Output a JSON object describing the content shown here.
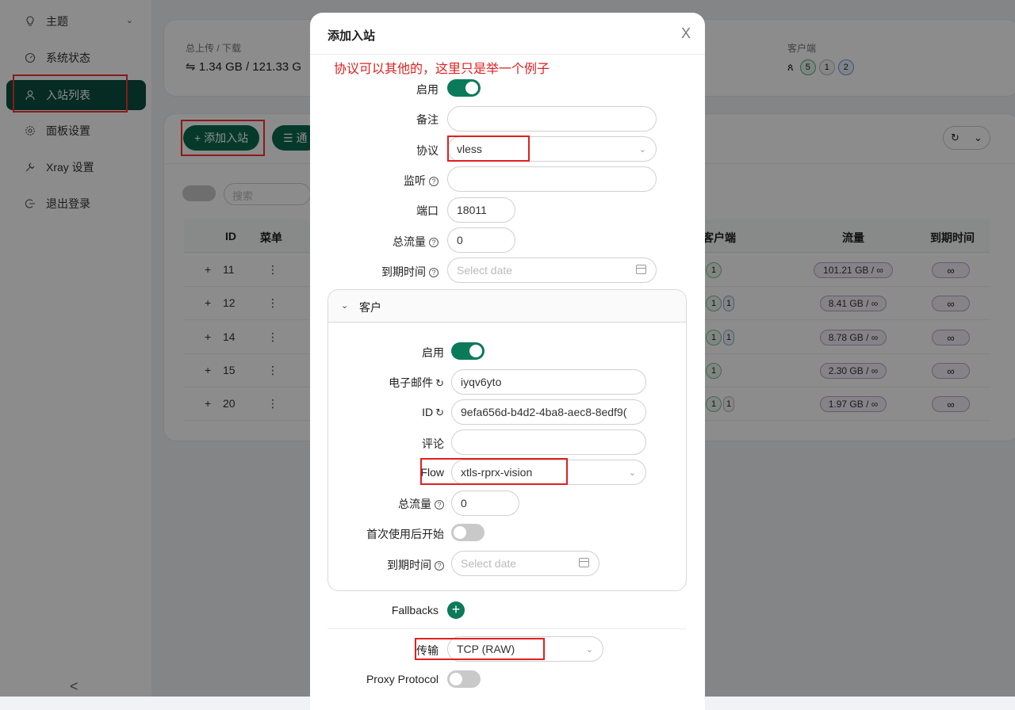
{
  "sidebar": {
    "items": [
      {
        "label": "主题",
        "icon": "lightbulb-icon"
      },
      {
        "label": "系统状态",
        "icon": "dashboard-icon"
      },
      {
        "label": "入站列表",
        "icon": "user-icon"
      },
      {
        "label": "面板设置",
        "icon": "gear-icon"
      },
      {
        "label": "Xray 设置",
        "icon": "tool-icon"
      },
      {
        "label": "退出登录",
        "icon": "logout-icon"
      }
    ],
    "collapse_label": "<"
  },
  "stats": {
    "traffic_label": "总上传 / 下载",
    "traffic_value": "⇋ 1.34 GB / 121.33 G",
    "clients_label": "客户端",
    "client_counts": [
      "5",
      "1",
      "2"
    ]
  },
  "toolbar": {
    "add_inbound": "+ 添加入站",
    "general_action": "☰ 通",
    "search_placeholder": "搜索"
  },
  "table": {
    "headers": {
      "id": "ID",
      "menu": "菜单",
      "clients": "客户端",
      "traffic": "流量",
      "expiry": "到期时间"
    },
    "rows": [
      {
        "id": "11",
        "traffic": "101.21 GB / ∞",
        "expiry": "∞"
      },
      {
        "id": "12",
        "traffic": "8.41 GB / ∞",
        "expiry": "∞"
      },
      {
        "id": "14",
        "traffic": "8.78 GB / ∞",
        "expiry": "∞"
      },
      {
        "id": "15",
        "traffic": "2.30 GB / ∞",
        "expiry": "∞"
      },
      {
        "id": "20",
        "traffic": "1.97 GB / ∞",
        "expiry": "∞"
      }
    ]
  },
  "modal": {
    "title": "添加入站",
    "close": "X",
    "note": "协议可以其他的，这里只是举一个例子",
    "fields": {
      "enable_label": "启用",
      "remark_label": "备注",
      "remark_value": "",
      "protocol_label": "协议",
      "protocol_value": "vless",
      "listen_label": "监听",
      "listen_value": "",
      "port_label": "端口",
      "port_value": "18011",
      "total_traffic_label": "总流量",
      "total_traffic_value": "0",
      "expiry_label": "到期时间",
      "expiry_placeholder": "Select date"
    },
    "client": {
      "section_title": "客户",
      "enable_label": "启用",
      "email_label": "电子邮件",
      "email_value": "iyqv6yto",
      "id_label": "ID",
      "id_value": "9efa656d-b4d2-4ba8-aec8-8edf9(",
      "comment_label": "评论",
      "comment_value": "",
      "flow_label": "Flow",
      "flow_value": "xtls-rprx-vision",
      "total_traffic_label": "总流量",
      "total_traffic_value": "0",
      "start_after_first_use_label": "首次使用后开始",
      "expiry_label": "到期时间",
      "expiry_placeholder": "Select date"
    },
    "fallbacks_label": "Fallbacks",
    "transport_label": "传输",
    "transport_value": "TCP (RAW)",
    "proxy_protocol_label": "Proxy Protocol"
  },
  "colors": {
    "accent": "#0a7a5a",
    "sidebar_active": "#0a4f3e",
    "annotation_red": "#e02020"
  }
}
